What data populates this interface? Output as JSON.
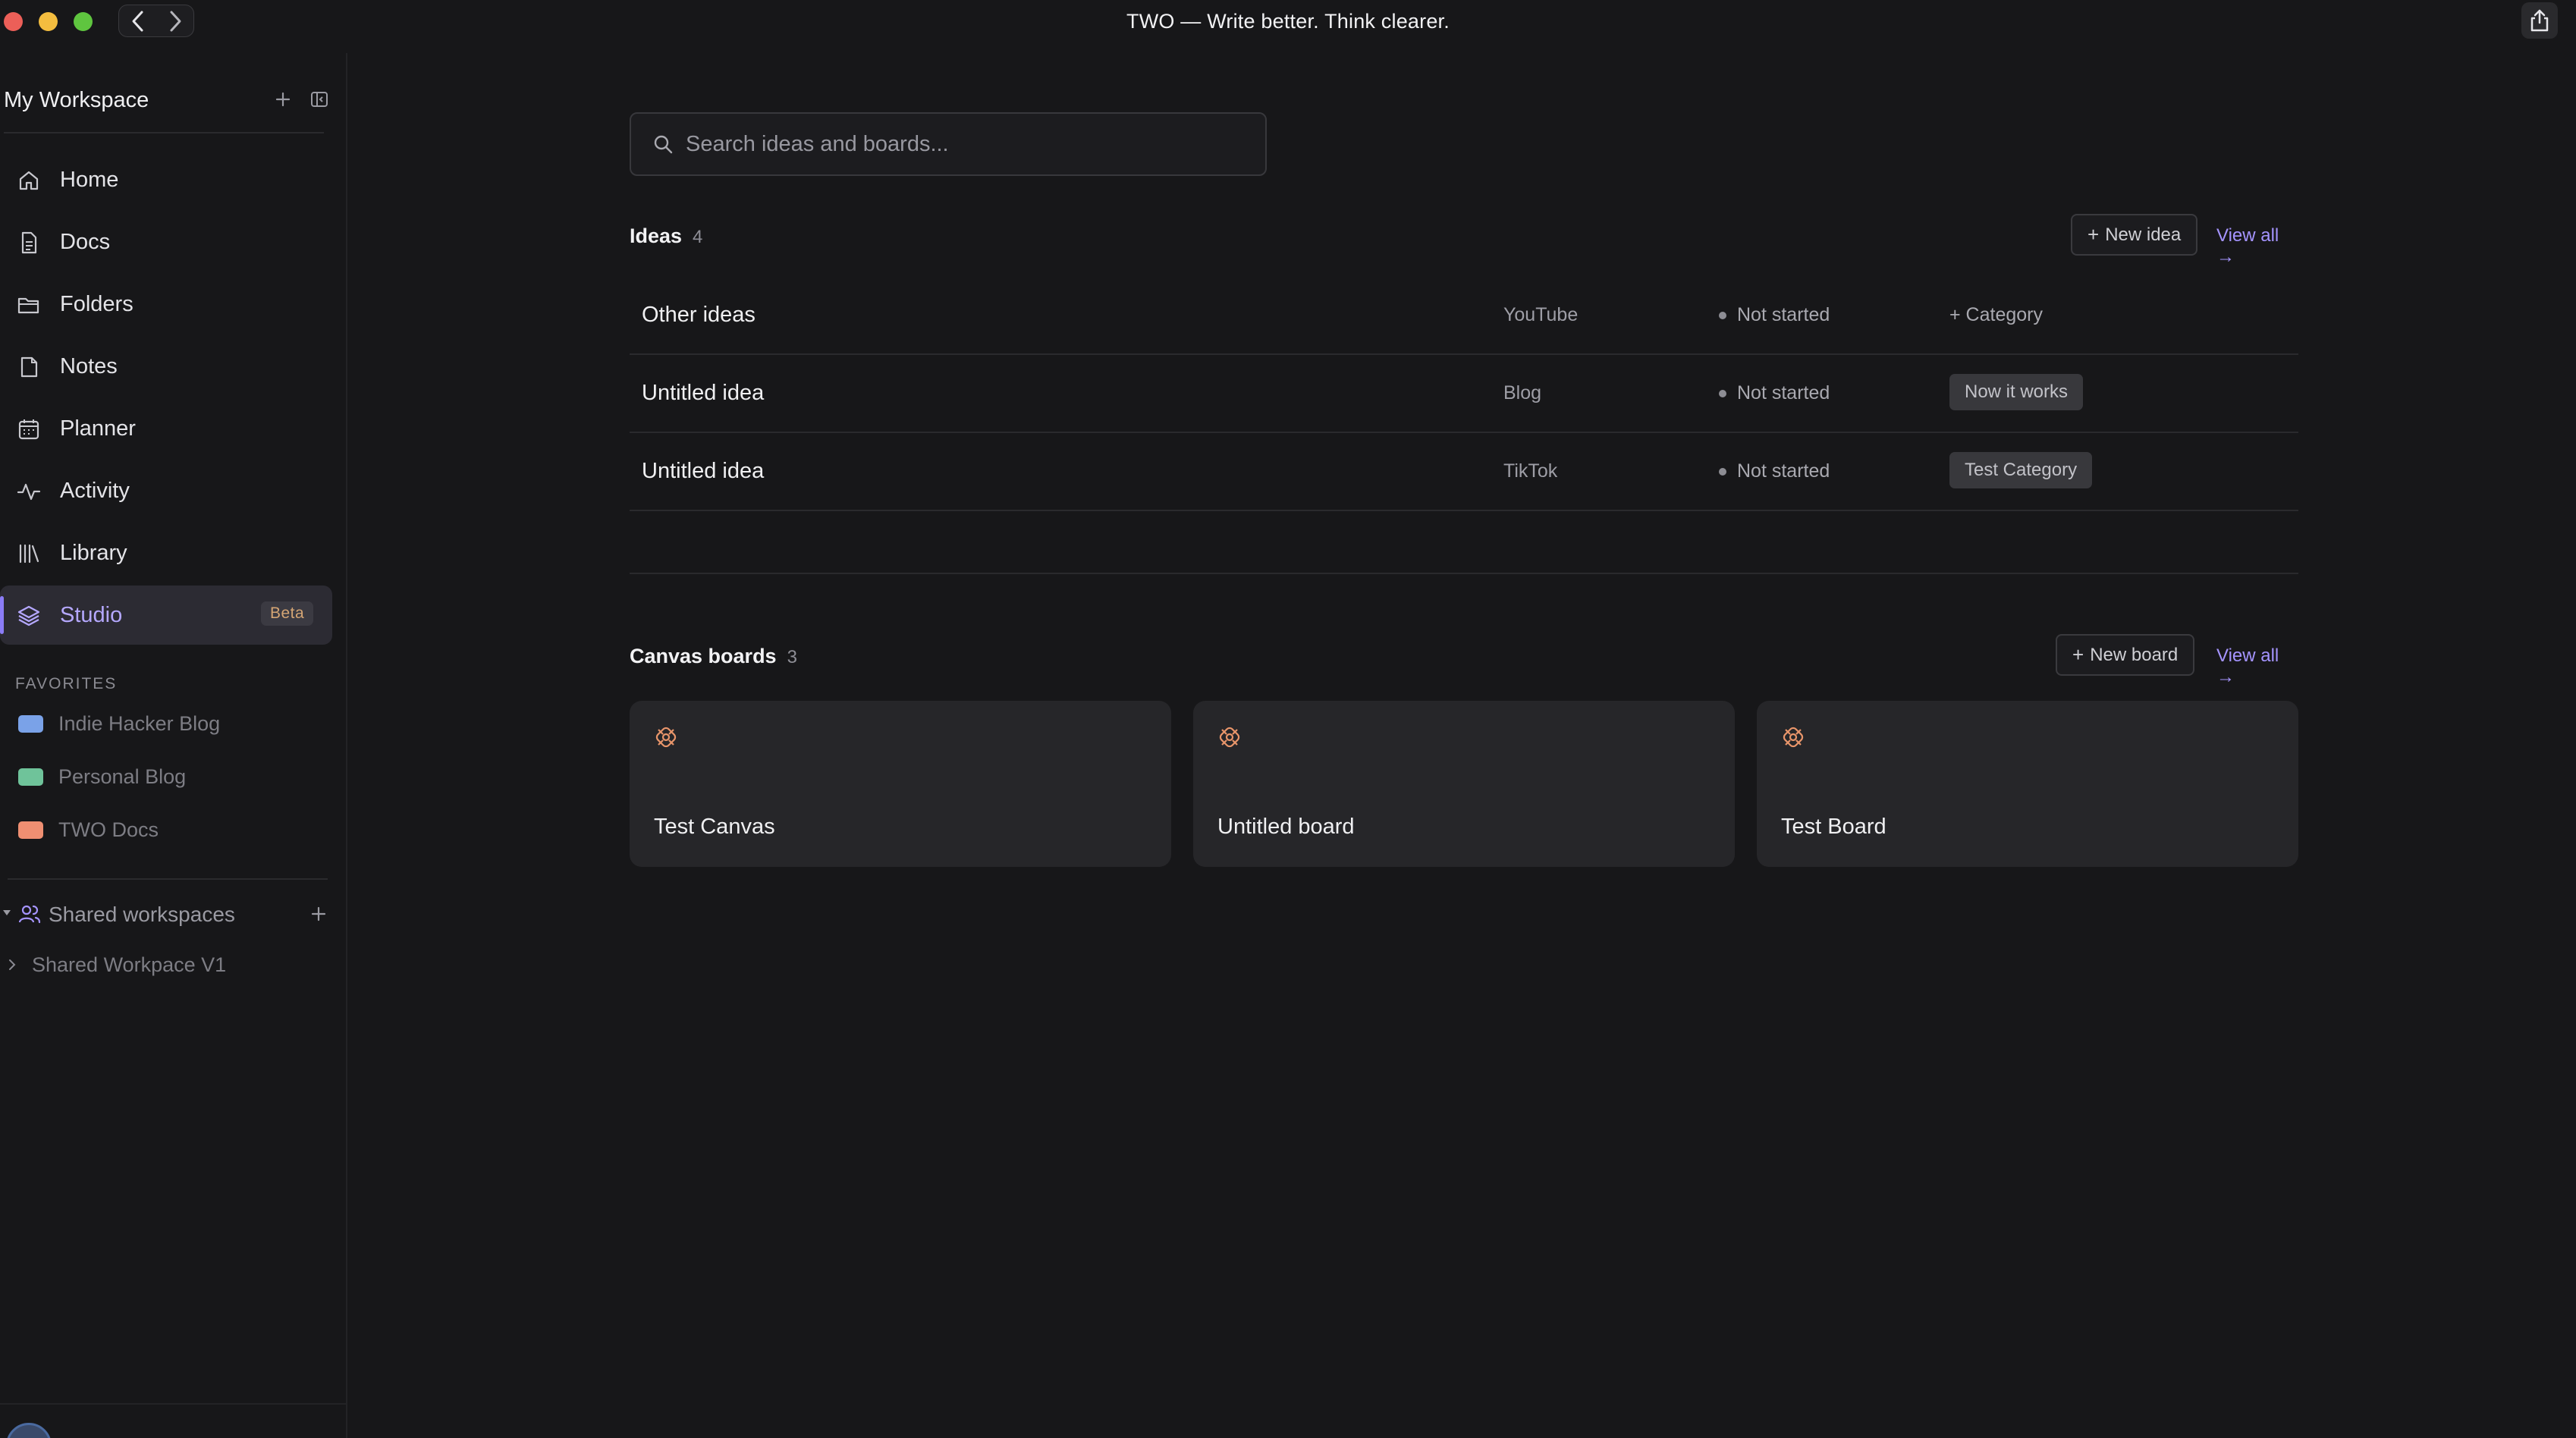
{
  "window": {
    "title": "TWO — Write better. Think clearer."
  },
  "sidebar": {
    "workspace_name": "My Workspace",
    "nav": [
      {
        "label": "Home",
        "icon": "home-icon"
      },
      {
        "label": "Docs",
        "icon": "doc-icon"
      },
      {
        "label": "Folders",
        "icon": "folder-icon"
      },
      {
        "label": "Notes",
        "icon": "note-icon"
      },
      {
        "label": "Planner",
        "icon": "calendar-icon"
      },
      {
        "label": "Activity",
        "icon": "activity-icon"
      },
      {
        "label": "Library",
        "icon": "library-icon"
      },
      {
        "label": "Studio",
        "icon": "layers-icon",
        "badge": "Beta",
        "active": true
      }
    ],
    "favorites_title": "FAVORITES",
    "favorites": [
      {
        "label": "Indie Hacker Blog",
        "color": "#7aa2e8"
      },
      {
        "label": "Personal Blog",
        "color": "#6fc39a"
      },
      {
        "label": "TWO Docs",
        "color": "#ef8f72"
      }
    ],
    "shared_title": "Shared workspaces",
    "shared_items": [
      {
        "label": "Shared Workpace V1"
      }
    ]
  },
  "main": {
    "search_placeholder": "Search ideas and boards...",
    "ideas": {
      "title": "Ideas",
      "count": "4",
      "new_label": "New idea",
      "view_all": "View all →",
      "rows": [
        {
          "name": "Other ideas",
          "channel": "YouTube",
          "status": "Not started",
          "category": "+ Category",
          "category_is_chip": false
        },
        {
          "name": "Untitled idea",
          "channel": "Blog",
          "status": "Not started",
          "category": "Now it works",
          "category_is_chip": true
        },
        {
          "name": "Untitled idea",
          "channel": "TikTok",
          "status": "Not started",
          "category": "Test Category",
          "category_is_chip": true
        }
      ]
    },
    "boards": {
      "title": "Canvas boards",
      "count": "3",
      "new_label": "New board",
      "view_all": "View all →",
      "items": [
        {
          "name": "Test Canvas",
          "icon": "canvas-icon"
        },
        {
          "name": "Untitled board",
          "icon": "canvas-icon"
        },
        {
          "name": "Test Board",
          "icon": "canvas-icon"
        }
      ]
    }
  },
  "colors": {
    "accent": "#a594ff",
    "background": "#171719",
    "board_icon": "#e8956a"
  }
}
